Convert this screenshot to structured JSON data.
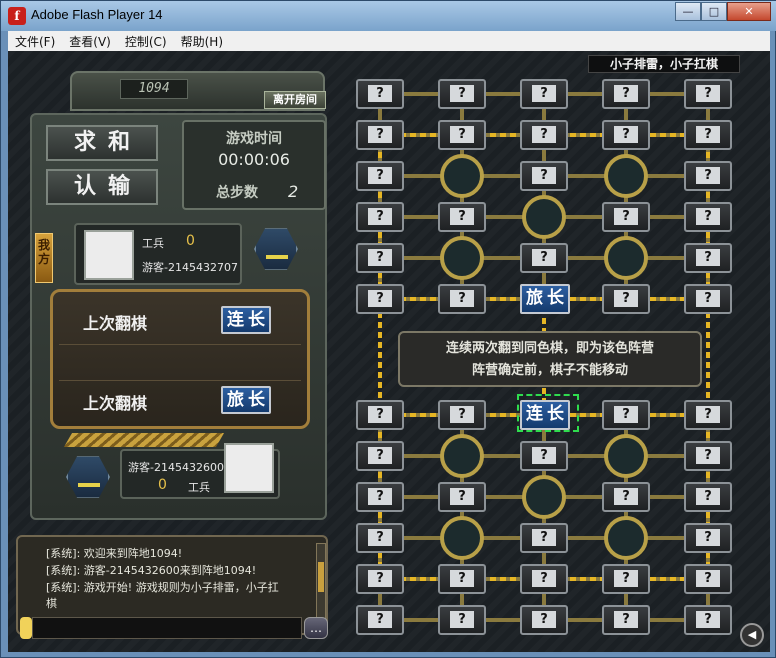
{
  "window": {
    "title": "Adobe Flash Player 14",
    "min": "—",
    "max": "□",
    "close": "✕"
  },
  "menu": [
    "文件(F)",
    "查看(V)",
    "控制(C)",
    "帮助(H)"
  ],
  "room": {
    "number": "1094",
    "leave": "离开房间"
  },
  "buttons": {
    "draw": "求和",
    "resign": "认输"
  },
  "timer": {
    "label": "游戏时间",
    "value": "00:00:06",
    "steps_label": "总步数",
    "steps": "2"
  },
  "me": {
    "tag": "我方",
    "rank": "工兵",
    "score": "0",
    "name": "游客-2145432707"
  },
  "opponent": {
    "name": "游客-2145432600",
    "score": "0",
    "rank": "工兵"
  },
  "last_flip": {
    "label": "上次翻棋",
    "mine": "连长",
    "theirs": "旅长"
  },
  "mode": "小子排雷，小子扛棋",
  "notice": [
    "连续两次翻到同色棋，即为该色阵营",
    "阵营确定前，棋子不能移动"
  ],
  "board": {
    "hidden": "?",
    "revealed_top": "旅长",
    "revealed_bottom": "连长"
  },
  "chat": [
    "[系统]: 欢迎来到阵地1094!",
    "[系统]: 游客-2145432600来到阵地1094!",
    "[系统]: 游戏开始! 游戏规则为小子排雷，小子扛",
    "棋"
  ],
  "colors": {
    "accent_gold": "#e6b624",
    "piece_blue": "#2d5fa1",
    "select_green": "#2fdc4e"
  }
}
